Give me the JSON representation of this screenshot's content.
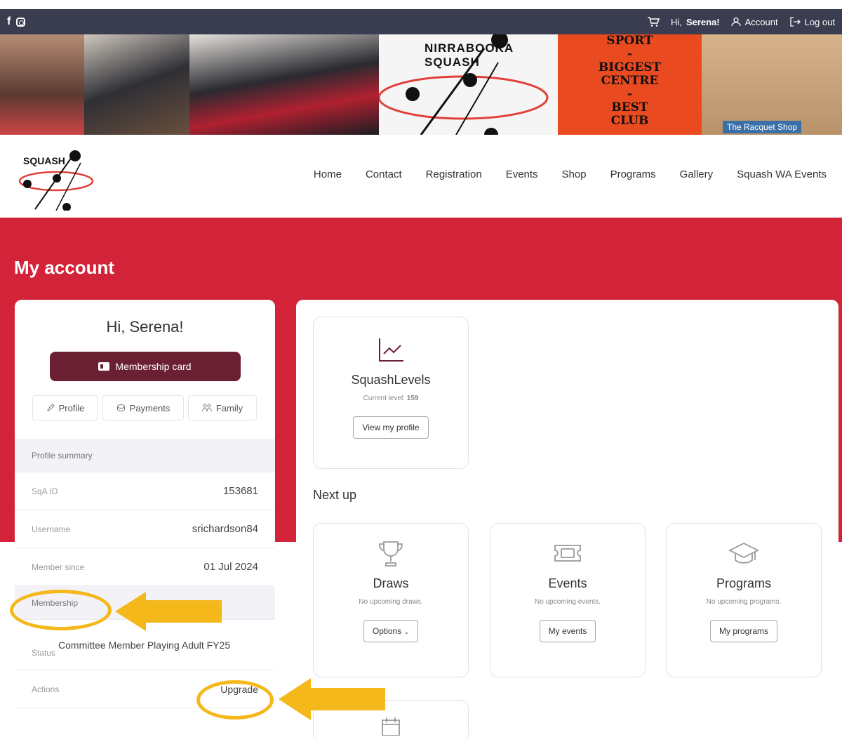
{
  "topbar": {
    "greeting_prefix": "Hi, ",
    "greeting_name": "Serena!",
    "account_label": "Account",
    "logout_label": "Log out"
  },
  "banner": {
    "logo_text": "NIRRABOOKA SQUASH",
    "sign_lines": [
      "SPORT",
      "-",
      "BIGGEST",
      "CENTRE",
      "-",
      "BEST",
      "CLUB"
    ],
    "racquet_text": "The Racquet Shop"
  },
  "nav": [
    "Home",
    "Contact",
    "Registration",
    "Events",
    "Shop",
    "Programs",
    "Gallery",
    "Squash WA Events"
  ],
  "page_title": "My account",
  "left": {
    "greeting": "Hi, Serena!",
    "membership_card_label": "Membership card",
    "tabs": [
      "Profile",
      "Payments",
      "Family"
    ],
    "profile_summary_label": "Profile summary",
    "sqa_id_label": "SqA ID",
    "sqa_id": "153681",
    "username_label": "Username",
    "username": "srichardson84",
    "member_since_label": "Member since",
    "member_since": "01 Jul 2024",
    "membership_label": "Membership",
    "status_label": "Status",
    "status_value": "Committee Member Playing Adult FY25",
    "actions_label": "Actions",
    "upgrade_label": "Upgrade"
  },
  "right": {
    "squashlevels": {
      "title": "SquashLevels",
      "level_prefix": "Current level: ",
      "level": "159",
      "button": "View my profile"
    },
    "next_up": "Next up",
    "draws": {
      "title": "Draws",
      "empty": "No upcoming draws.",
      "button": "Options"
    },
    "events": {
      "title": "Events",
      "empty": "No upcoming events.",
      "button": "My events"
    },
    "programs": {
      "title": "Programs",
      "empty": "No upcoming programs.",
      "button": "My programs"
    }
  },
  "colors": {
    "topbar": "#3a3d4f",
    "red": "#d32338",
    "maroon": "#6b1f32",
    "highlight": "#f4b81a"
  }
}
